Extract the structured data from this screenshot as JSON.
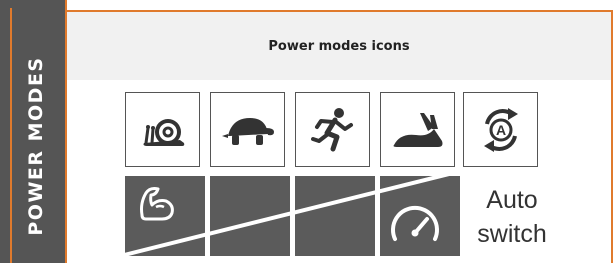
{
  "sidebar": {
    "title": "POWER MODES"
  },
  "panel": {
    "title": "Power modes icons"
  },
  "icons": [
    {
      "name": "snail-icon"
    },
    {
      "name": "turtle-icon"
    },
    {
      "name": "running-person-icon"
    },
    {
      "name": "rabbit-icon"
    },
    {
      "name": "auto-mode-icon"
    }
  ],
  "bottom": {
    "auto_line1": "Auto",
    "auto_line2": "switch"
  },
  "colors": {
    "accent": "#e07a2c",
    "band": "#555555",
    "tile": "#5b5b5b"
  }
}
